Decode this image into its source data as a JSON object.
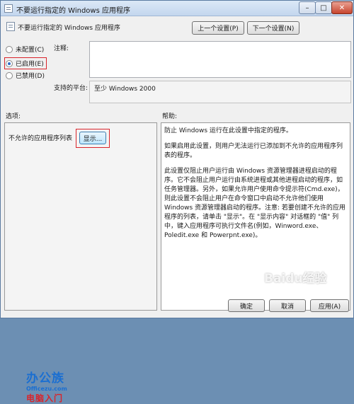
{
  "window": {
    "title": "不要运行指定的 Windows 应用程序",
    "minimize": "–",
    "maximize": "□",
    "close": "✕"
  },
  "header": {
    "policy_name": "不要运行指定的 Windows 应用程序",
    "prev_button": "上一个设置(P)",
    "next_button": "下一个设置(N)"
  },
  "state_options": [
    {
      "label": "未配置(C)",
      "selected": false
    },
    {
      "label": "已启用(E)",
      "selected": true
    },
    {
      "label": "已禁用(D)",
      "selected": false
    }
  ],
  "comment": {
    "label": "注释:",
    "value": ""
  },
  "platform": {
    "label": "支持的平台:",
    "value": "至少 Windows 2000"
  },
  "options": {
    "heading": "选项:",
    "list_label": "不允许的应用程序列表",
    "show_button": "显示..."
  },
  "help": {
    "heading": "帮助:",
    "paragraphs": [
      "防止 Windows 运行在此设置中指定的程序。",
      "如果启用此设置，则用户无法运行已添加到不允许的应用程序列表的程序。",
      "此设置仅阻止用户运行由 Windows 资源管理器进程启动的程序。它不会阻止用户运行由系统进程或其他进程启动的程序，如任务管理器。另外，如果允许用户使用命令提示符(Cmd.exe)，则此设置不会阻止用户在命令窗口中启动不允许他们使用 Windows 资源管理器启动的程序。注意: 若要创建不允许的应用程序的列表，请单击 \"显示\"。在 \"显示内容\" 对话框的 \"值\" 列中，键入应用程序可执行文件名(例如，Winword.exe、Poledit.exe 和 Powerpnt.exe)。"
    ]
  },
  "logo": {
    "main": "办公族",
    "url": "Officezu.com",
    "sub": "电脑入门"
  },
  "watermark": "Baidu经验",
  "footer": {
    "ok": "确定",
    "cancel": "取消",
    "apply": "应用(A)"
  },
  "colors": {
    "highlight_border": "#d9242b",
    "radio_selected": "#2d6bc9",
    "logo_blue": "#1b6fd1"
  },
  "icons": {
    "title": "policy-document-icon",
    "header": "policy-document-icon"
  }
}
